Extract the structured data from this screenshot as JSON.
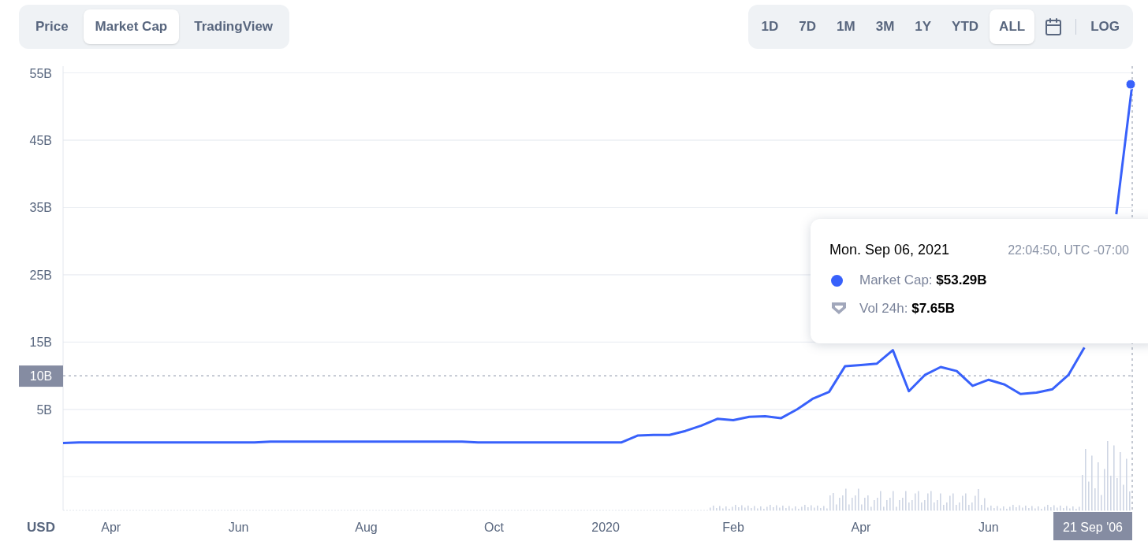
{
  "chart_tabs": [
    {
      "label": "Price",
      "selected": false
    },
    {
      "label": "Market Cap",
      "selected": true
    },
    {
      "label": "TradingView",
      "selected": false
    }
  ],
  "range_buttons": [
    {
      "label": "1D",
      "selected": false
    },
    {
      "label": "7D",
      "selected": false
    },
    {
      "label": "1M",
      "selected": false
    },
    {
      "label": "3M",
      "selected": false
    },
    {
      "label": "1Y",
      "selected": false
    },
    {
      "label": "YTD",
      "selected": false
    },
    {
      "label": "ALL",
      "selected": true
    }
  ],
  "log_button": {
    "label": "LOG",
    "selected": false
  },
  "chart": {
    "currency_label": "USD",
    "crosshair_y_label": "10B",
    "crosshair_x_label": "21 Sep '06",
    "chart_data": {
      "type": "line",
      "ylim": [
        -10,
        56
      ],
      "grid": true,
      "ref_lines": [
        {
          "axis": "y",
          "value": 10
        }
      ],
      "categories": [
        null,
        null,
        null,
        "Apr",
        null,
        null,
        null,
        null,
        null,
        null,
        null,
        "Jun",
        null,
        null,
        null,
        null,
        null,
        null,
        null,
        "Aug",
        null,
        null,
        null,
        null,
        null,
        null,
        null,
        "Oct",
        null,
        null,
        null,
        null,
        null,
        null,
        "2020",
        null,
        null,
        null,
        null,
        null,
        null,
        null,
        "Feb",
        null,
        null,
        null,
        null,
        null,
        null,
        null,
        "Apr",
        null,
        null,
        null,
        null,
        null,
        null,
        null,
        "Jun",
        null,
        null,
        null,
        null,
        null,
        null,
        null,
        null,
        null
      ],
      "yticks": [
        {
          "value": 5,
          "label": "5B"
        },
        {
          "value": 15,
          "label": "15B"
        },
        {
          "value": 25,
          "label": "25B"
        },
        {
          "value": 35,
          "label": "35B"
        },
        {
          "value": 45,
          "label": "45B"
        },
        {
          "value": 55,
          "label": "55B"
        }
      ],
      "series": [
        {
          "color": "#3861fb",
          "values": [
            0,
            0.1,
            0.1,
            0.1,
            0.1,
            0.1,
            0.1,
            0.1,
            0.1,
            0.1,
            0.1,
            0.1,
            0.1,
            0.2,
            0.2,
            0.2,
            0.2,
            0.2,
            0.2,
            0.2,
            0.2,
            0.2,
            0.2,
            0.2,
            0.2,
            0.2,
            0.1,
            0.1,
            0.1,
            0.1,
            0.1,
            0.1,
            0.1,
            0.1,
            0.1,
            0.1,
            1.1,
            1.2,
            1.2,
            1.8,
            2.6,
            3.6,
            3.4,
            3.9,
            4.0,
            3.7,
            5.0,
            6.6,
            7.6,
            11.4,
            11.6,
            11.8,
            13.8,
            7.7,
            10.1,
            11.3,
            10.7,
            8.5,
            9.4,
            8.7,
            7.3,
            7.5,
            8.0,
            10.1,
            14.2,
            null,
            34,
            53.3
          ]
        }
      ]
    }
  },
  "tooltip": {
    "date": "Mon. Sep 06, 2021",
    "time": "22:04:50, UTC -07:00",
    "rows": [
      {
        "kind": "dot",
        "label": "Market Cap:",
        "value": "$53.29B",
        "color": "#3861fb"
      },
      {
        "kind": "shield",
        "label": "Vol 24h:",
        "value": "$7.65B",
        "color": "#a1a7bb"
      }
    ]
  }
}
